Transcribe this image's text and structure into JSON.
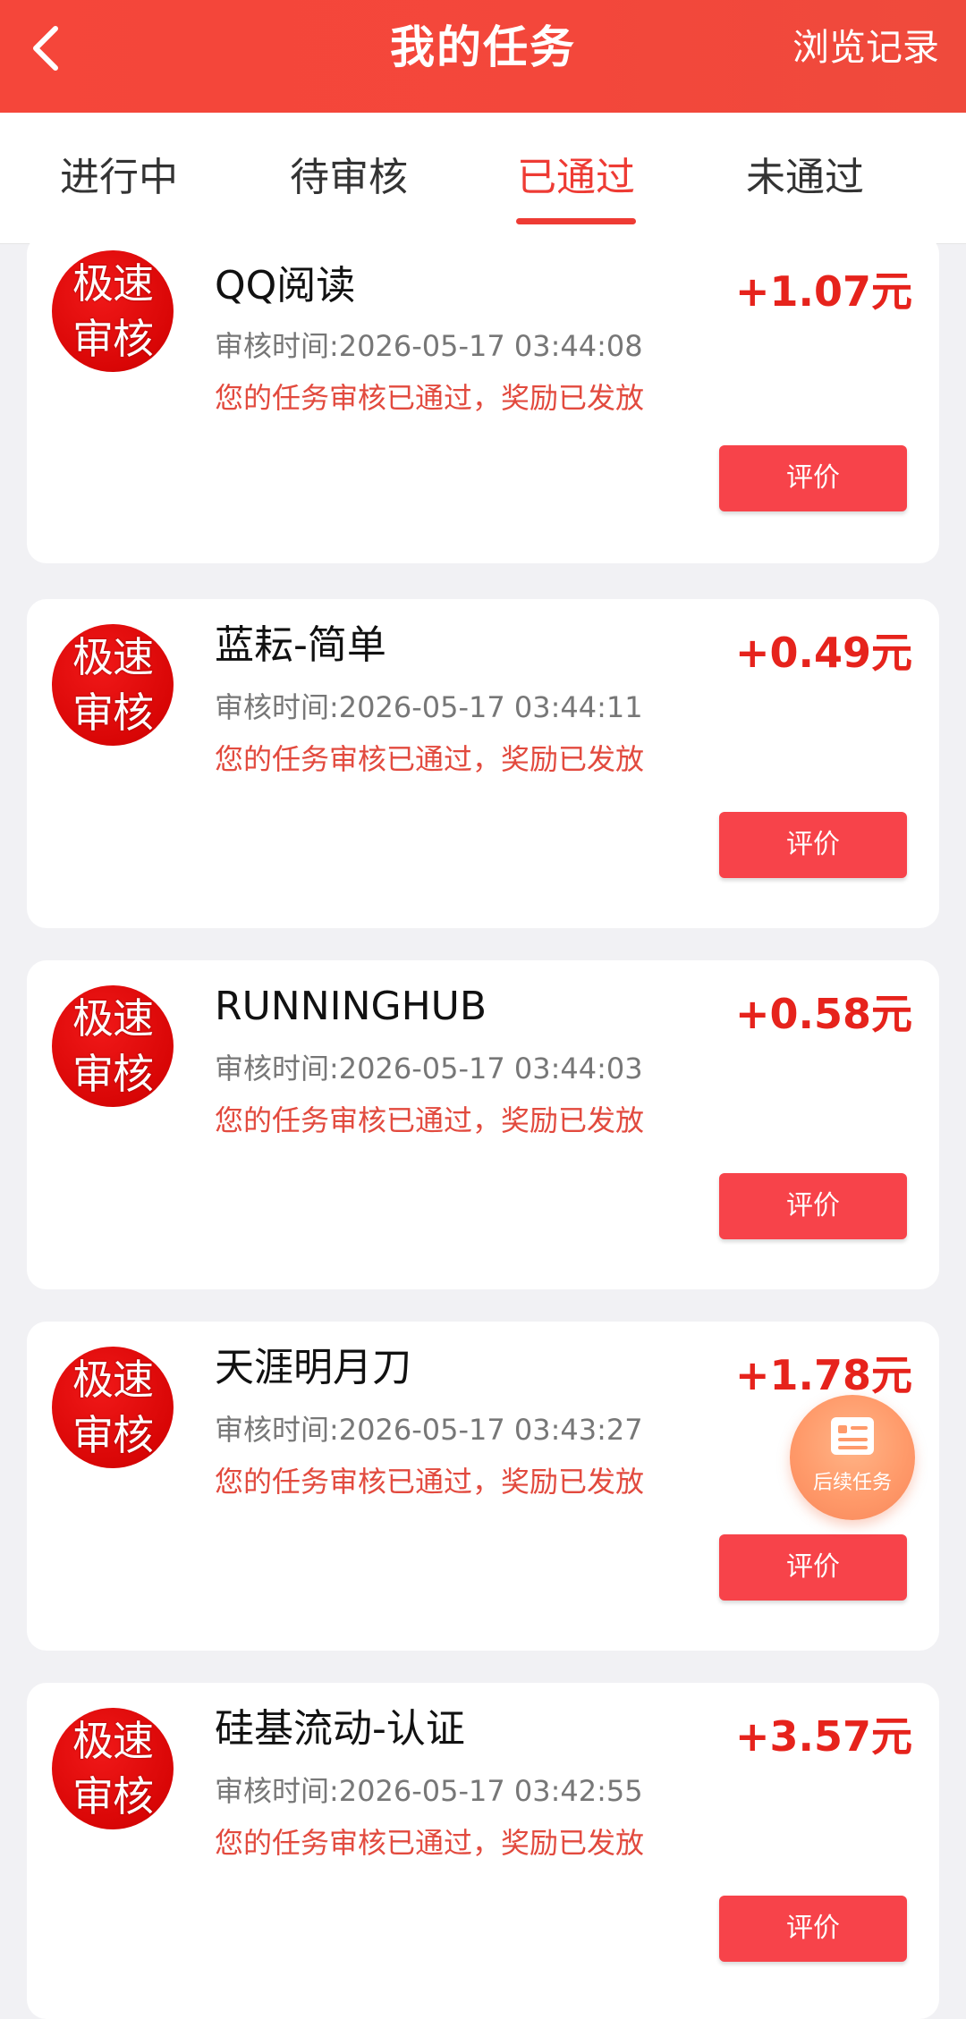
{
  "header": {
    "title": "我的任务",
    "right_link": "浏览记录",
    "back_icon": "chevron-left-icon",
    "bg_color": "#f4463a"
  },
  "tabs": [
    {
      "label": "进行中",
      "active": false
    },
    {
      "label": "待审核",
      "active": false
    },
    {
      "label": "已通过",
      "active": true
    },
    {
      "label": "未通过",
      "active": false
    }
  ],
  "badge": {
    "line1": "极速",
    "line2": "审核"
  },
  "review_button_label": "评价",
  "tasks": [
    {
      "name": "QQ阅读",
      "time": "审核时间:2026-05-17 03:44:08",
      "status": "您的任务审核已通过，奖励已发放",
      "reward": "+1.07元"
    },
    {
      "name": "蓝耘-简单",
      "time": "审核时间:2026-05-17 03:44:11",
      "status": "您的任务审核已通过，奖励已发放",
      "reward": "+0.49元"
    },
    {
      "name": "RUNNINGHUB",
      "time": "审核时间:2026-05-17 03:44:03",
      "status": "您的任务审核已通过，奖励已发放",
      "reward": "+0.58元"
    },
    {
      "name": "天涯明月刀",
      "time": "审核时间:2026-05-17 03:43:27",
      "status": "您的任务审核已通过，奖励已发放",
      "reward": "+1.78元"
    },
    {
      "name": "硅基流动-认证",
      "time": "审核时间:2026-05-17 03:42:55",
      "status": "您的任务审核已通过，奖励已发放",
      "reward": "+3.57元"
    }
  ],
  "float_button": {
    "label": "后续任务",
    "icon": "document-icon"
  },
  "colors": {
    "accent": "#ee3b34",
    "reward": "#e6231c",
    "button": "#f7434a"
  }
}
